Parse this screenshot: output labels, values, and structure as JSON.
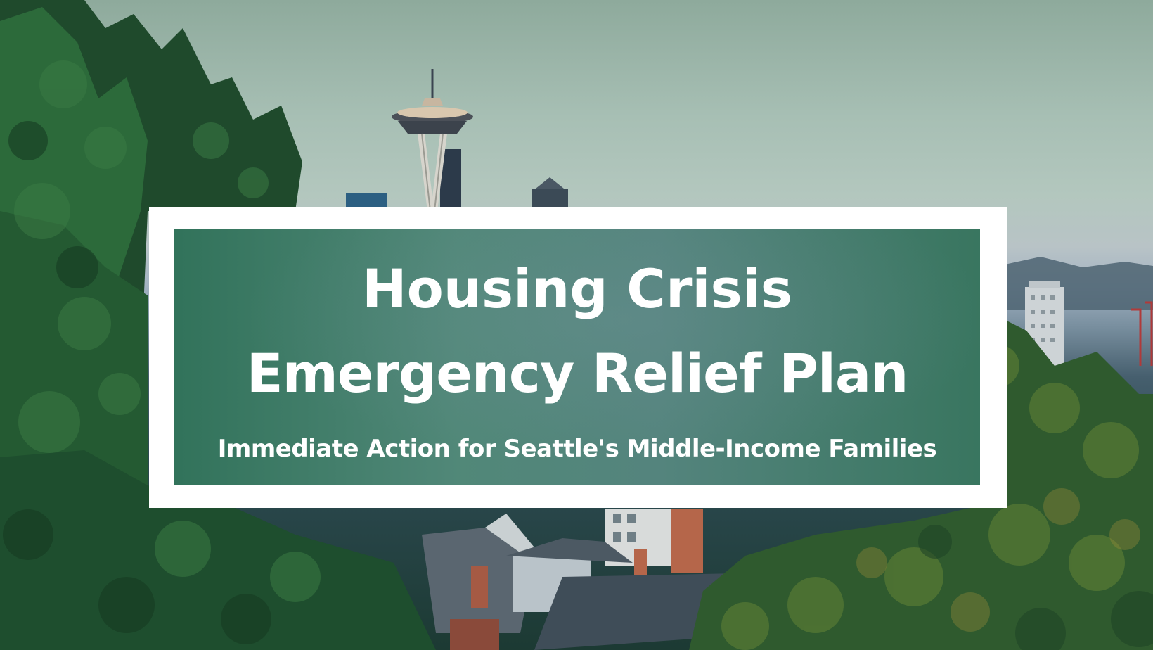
{
  "banner": {
    "title_line1": "Housing Crisis",
    "title_line2": "Emergency Relief Plan",
    "subtitle": "Immediate Action for Seattle's Middle-Income Families"
  },
  "colors": {
    "panel_green": "#22684e",
    "frame_white": "#ffffff",
    "text_white": "#ffffff",
    "tree_dark": "#1e4a2c",
    "tree_mid": "#2f6a3a"
  }
}
